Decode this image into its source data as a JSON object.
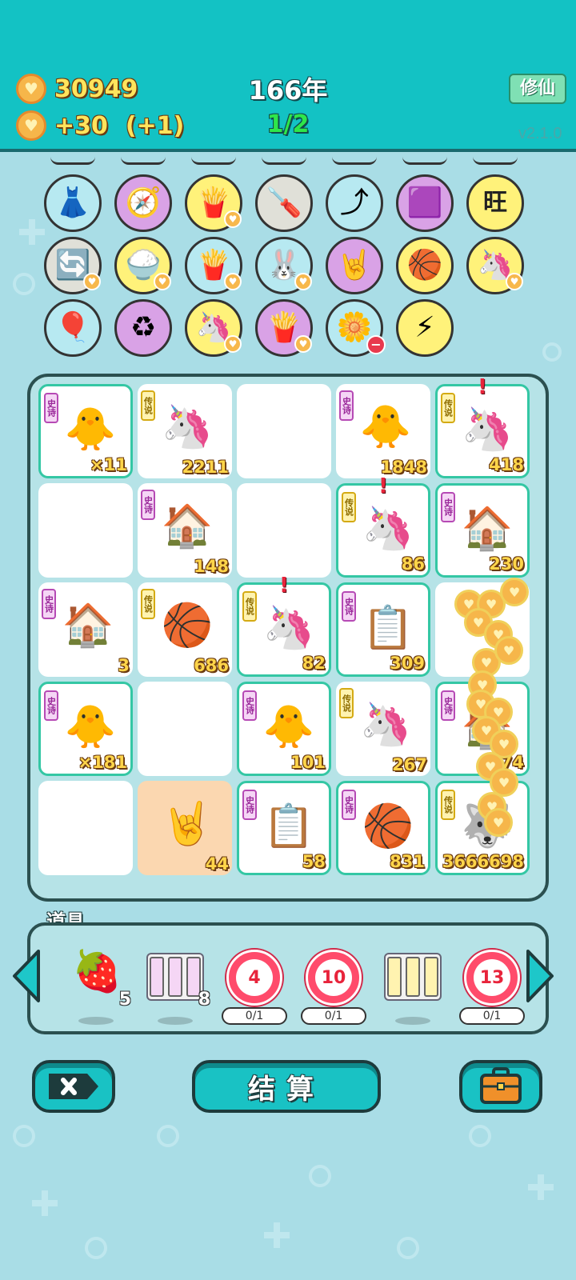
{
  "header": {
    "gold": "30949",
    "income": "+30",
    "income_bonus": "(+1)",
    "year": "166年",
    "wave": "1/2",
    "cultivate_label": "修仙",
    "version": "v2.1.0"
  },
  "symbols": [
    {
      "name": "skirt-icon",
      "glyph": "👗",
      "bg": "#b7e9f1"
    },
    {
      "name": "compass-icon",
      "glyph": "🧭",
      "bg": "#d9a2e6"
    },
    {
      "name": "fries-icon",
      "glyph": "🍟",
      "bg": "#fff27a"
    },
    {
      "name": "screwdriver-icon",
      "glyph": "🪛",
      "bg": "#e0e0d8"
    },
    {
      "name": "arrow-up-icon",
      "glyph": "⤴",
      "bg": "#b7e9f1"
    },
    {
      "name": "box-icon",
      "glyph": "🟪",
      "bg": "#d9a2e6"
    },
    {
      "name": "wang-icon",
      "glyph": "旺",
      "bg": "#fff27a"
    },
    {
      "name": "recycle-arrows-icon",
      "glyph": "🔄",
      "bg": "#e0e0d8"
    },
    {
      "name": "rice-bowl-icon",
      "glyph": "🍚",
      "bg": "#fff27a"
    },
    {
      "name": "fries-icon",
      "glyph": "🍟",
      "bg": "#b7e9f1"
    },
    {
      "name": "rabbit-icon",
      "glyph": "🐰",
      "bg": "#b7e9f1"
    },
    {
      "name": "rock-hand-icon",
      "glyph": "🤘",
      "bg": "#d9a2e6"
    },
    {
      "name": "basketballs-icon",
      "glyph": "🏀",
      "bg": "#fff27a"
    },
    {
      "name": "unicorn-icon",
      "glyph": "🦄",
      "bg": "#fff27a"
    },
    {
      "name": "pump-icon",
      "glyph": "🎈",
      "bg": "#b7e9f1"
    },
    {
      "name": "recycle-icon",
      "glyph": "♻",
      "bg": "#d9a2e6"
    },
    {
      "name": "unicorn-icon",
      "glyph": "🦄",
      "bg": "#fff27a"
    },
    {
      "name": "fries-icon",
      "glyph": "🍟",
      "bg": "#d9a2e6"
    },
    {
      "name": "flower-pot-icon",
      "glyph": "🌼",
      "bg": "#b7e9f1"
    },
    {
      "name": "lightning-icon",
      "glyph": "⚡",
      "bg": "#fff27a"
    }
  ],
  "board": [
    {
      "tag": "史诗",
      "tag_type": "epic",
      "icon": "chick-icon",
      "glyph": "🐥",
      "value": "×11",
      "framed": true
    },
    {
      "tag": "传说",
      "tag_type": "legend",
      "icon": "unicorn-icon",
      "glyph": "🦄",
      "value": "2211",
      "framed": false
    },
    {
      "tag": "",
      "tag_type": "",
      "icon": "",
      "glyph": "",
      "value": "",
      "framed": false
    },
    {
      "tag": "史诗",
      "tag_type": "epic",
      "icon": "crowned-chick-icon",
      "glyph": "🐥",
      "value": "1848",
      "framed": false
    },
    {
      "tag": "传说",
      "tag_type": "legend",
      "icon": "crowned-unicorn-icon",
      "glyph": "🦄",
      "value": "418",
      "framed": true,
      "excl": "!"
    },
    {
      "tag": "",
      "tag_type": "",
      "icon": "",
      "glyph": "",
      "value": "",
      "framed": false
    },
    {
      "tag": "史诗",
      "tag_type": "epic",
      "icon": "rabbit-house-icon",
      "glyph": "🏠",
      "value": "148",
      "framed": false
    },
    {
      "tag": "",
      "tag_type": "",
      "icon": "",
      "glyph": "",
      "value": "",
      "framed": false
    },
    {
      "tag": "传说",
      "tag_type": "legend",
      "icon": "unicorn-icon",
      "glyph": "🦄",
      "value": "86",
      "framed": true,
      "excl": "!"
    },
    {
      "tag": "史诗",
      "tag_type": "epic",
      "icon": "rabbit-house-icon",
      "glyph": "🏠",
      "value": "230",
      "framed": true
    },
    {
      "tag": "史诗",
      "tag_type": "epic",
      "icon": "rabbit-house-icon",
      "glyph": "🏠",
      "value": "3",
      "framed": false
    },
    {
      "tag": "传说",
      "tag_type": "legend",
      "icon": "fridge-basketball-icon",
      "glyph": "🏀",
      "value": "686",
      "framed": false
    },
    {
      "tag": "传说",
      "tag_type": "legend",
      "icon": "unicorn-icon",
      "glyph": "🦄",
      "value": "82",
      "framed": true,
      "excl": "!"
    },
    {
      "tag": "史诗",
      "tag_type": "epic",
      "icon": "copy-paste-icon",
      "glyph": "📋",
      "value": "309",
      "framed": true
    },
    {
      "tag": "",
      "tag_type": "",
      "icon": "",
      "glyph": "",
      "value": "",
      "framed": false
    },
    {
      "tag": "史诗",
      "tag_type": "epic",
      "icon": "chick-icon",
      "glyph": "🐥",
      "value": "×181",
      "framed": true
    },
    {
      "tag": "",
      "tag_type": "",
      "icon": "",
      "glyph": "",
      "value": "",
      "framed": false
    },
    {
      "tag": "史诗",
      "tag_type": "epic",
      "icon": "chick-icon",
      "glyph": "🐥",
      "value": "101",
      "framed": true
    },
    {
      "tag": "传说",
      "tag_type": "legend",
      "icon": "unicorn-basketball-icon",
      "glyph": "🦄",
      "value": "267",
      "framed": false
    },
    {
      "tag": "史诗",
      "tag_type": "epic",
      "icon": "rabbit-house-icon",
      "glyph": "🏠",
      "value": "74",
      "framed": true
    },
    {
      "tag": "",
      "tag_type": "",
      "icon": "",
      "glyph": "",
      "value": "",
      "framed": false
    },
    {
      "tag": "",
      "tag_type": "",
      "icon": "rock-hand-icon",
      "glyph": "🤘",
      "value": "44",
      "framed": false,
      "peach": true
    },
    {
      "tag": "史诗",
      "tag_type": "epic",
      "icon": "copy-paste-icon",
      "glyph": "📋",
      "value": "58",
      "framed": true
    },
    {
      "tag": "史诗",
      "tag_type": "epic",
      "icon": "basketball-card-icon",
      "glyph": "🏀",
      "value": "831",
      "framed": true
    },
    {
      "tag": "传说",
      "tag_type": "legend",
      "icon": "husky-icon",
      "glyph": "🐺",
      "value": "3666698",
      "framed": true
    }
  ],
  "items": {
    "title": "道具",
    "list": [
      {
        "kind": "lychee",
        "name": "lychee-icon",
        "glyph": "🍓",
        "count": "5"
      },
      {
        "kind": "cards-epic",
        "name": "epic-cards-icon",
        "count": "8"
      },
      {
        "kind": "target",
        "name": "target-icon",
        "number": "4",
        "progress": "0/1"
      },
      {
        "kind": "target",
        "name": "target-icon",
        "number": "10",
        "progress": "0/1"
      },
      {
        "kind": "cards-legend",
        "name": "legend-cards-icon",
        "count": ""
      },
      {
        "kind": "target",
        "name": "target-icon",
        "number": "13",
        "progress": "0/1"
      }
    ]
  },
  "buttons": {
    "settle_label": "结算"
  }
}
